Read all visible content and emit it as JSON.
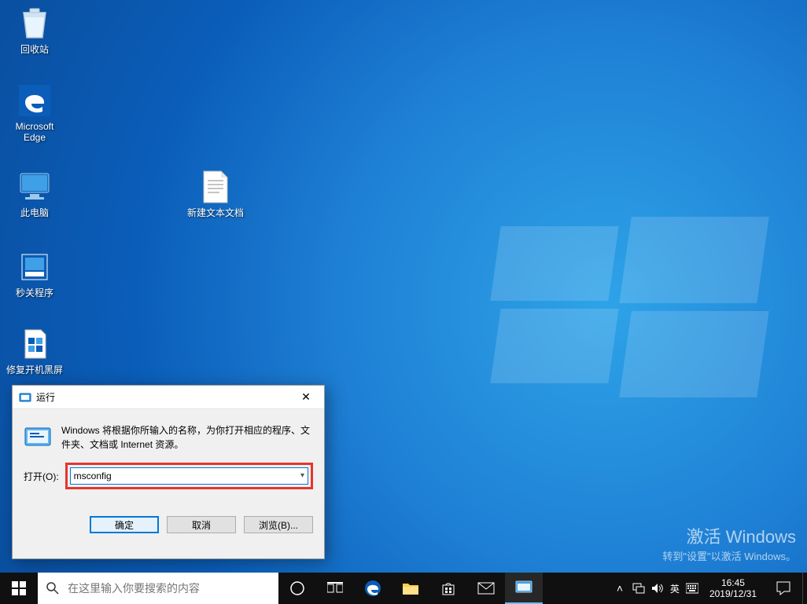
{
  "desktop_icons": {
    "recycle_bin": "回收站",
    "edge": "Microsoft Edge",
    "this_pc": "此电脑",
    "text_doc": "新建文本文档",
    "shutdown_tool": "秒关程序",
    "repair_tool": "修复开机黑屏"
  },
  "watermark": {
    "line1": "激活 Windows",
    "line2": "转到\"设置\"以激活 Windows。"
  },
  "run_dialog": {
    "title": "运行",
    "info_text": "Windows 将根据你所输入的名称，为你打开相应的程序、文件夹、文档或 Internet 资源。",
    "open_label": "打开(O):",
    "input_value": "msconfig",
    "btn_ok": "确定",
    "btn_cancel": "取消",
    "btn_browse": "浏览(B)..."
  },
  "taskbar": {
    "search_placeholder": "在这里输入你要搜索的内容",
    "ime_lang": "英",
    "ime_mode": "⌨",
    "time": "16:45",
    "date": "2019/12/31"
  }
}
